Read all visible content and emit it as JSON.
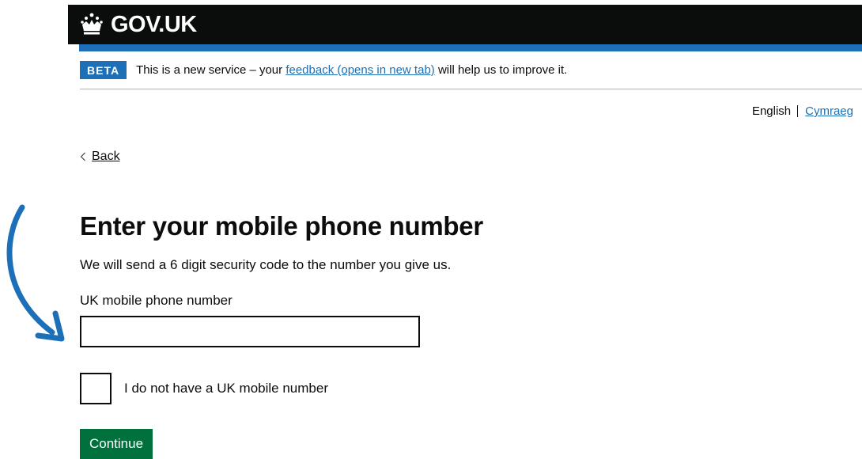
{
  "header": {
    "logo_text": "GOV.UK",
    "logo_icon": "crown-icon"
  },
  "phase_banner": {
    "tag": "BETA",
    "text_before": "This is a new service – your ",
    "link_text": "feedback (opens in new tab)",
    "text_after": " will help us to improve it."
  },
  "language": {
    "current": "English",
    "alternate": "Cymraeg"
  },
  "back_link": {
    "label": "Back",
    "icon": "chevron-left-icon"
  },
  "page": {
    "heading": "Enter your mobile phone number",
    "intro": "We will send a 6 digit security code to the number you give us.",
    "phone_field": {
      "label": "UK mobile phone number",
      "value": ""
    },
    "no_mobile_checkbox": {
      "label": "I do not have a UK mobile number",
      "checked": false
    },
    "continue_label": "Continue"
  },
  "annotation": {
    "icon": "curved-arrow-icon",
    "color": "#1d70b8"
  },
  "colors": {
    "header_bg": "#0b0c0c",
    "brand_blue": "#1d70b8",
    "button_green": "#00703c",
    "text": "#0b0c0c"
  }
}
